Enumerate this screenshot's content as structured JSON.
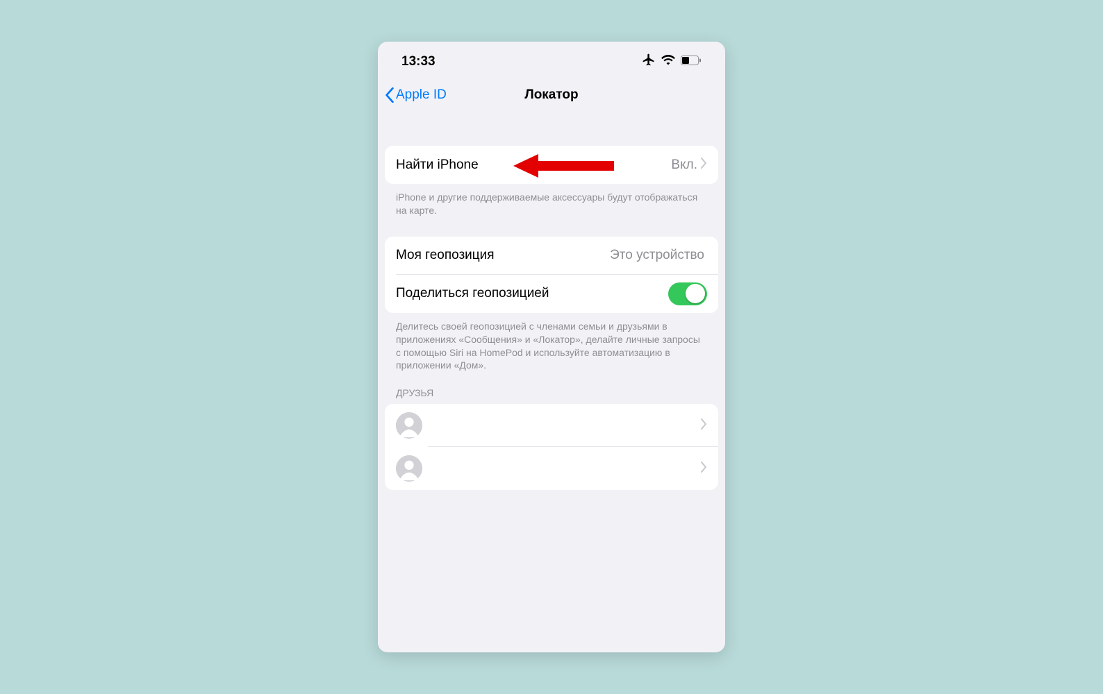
{
  "status": {
    "time": "13:33"
  },
  "nav": {
    "back": "Apple ID",
    "title": "Локатор"
  },
  "findIphone": {
    "label": "Найти iPhone",
    "value": "Вкл.",
    "footer": "iPhone и другие поддерживаемые аксессуары будут отображаться на карте."
  },
  "geo": {
    "myLocationLabel": "Моя геопозиция",
    "myLocationValue": "Это устройство",
    "shareLabel": "Поделиться геопозицией",
    "shareEnabled": true,
    "footer": "Делитесь своей геопозицией с членами семьи и друзьями в приложениях «Сообщения» и «Локатор», делайте личные запросы с помощью Siri на HomePod и используйте автоматизацию в приложении «Дом»."
  },
  "friends": {
    "header": "ДРУЗЬЯ",
    "items": [
      {
        "name": ""
      },
      {
        "name": ""
      }
    ]
  }
}
